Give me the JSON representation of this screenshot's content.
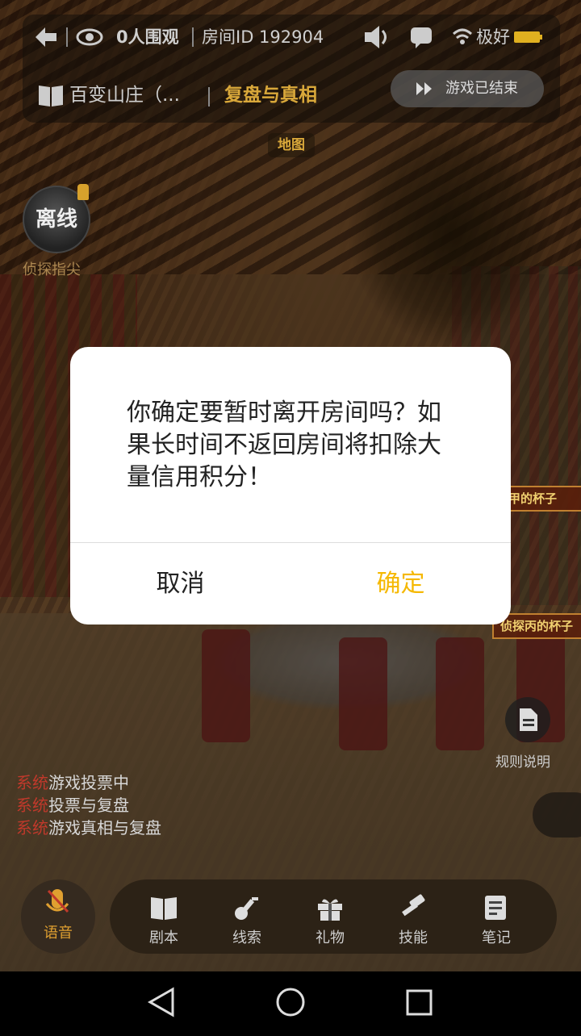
{
  "header": {
    "viewers": "0人围观",
    "room_id": "房间ID 192904",
    "network": "极好",
    "script_title": "百变山庄（...",
    "phase": "复盘与真相",
    "game_status": "游戏已结束",
    "map_label": "地图"
  },
  "player": {
    "status": "离线",
    "name": "侦探指尖"
  },
  "scene_tags": {
    "cup_a": "甲的杯子",
    "cup_b": "侦探丙的杯子"
  },
  "rules": {
    "label": "规则说明"
  },
  "system_log": [
    {
      "source": "系统",
      "message": "游戏投票中"
    },
    {
      "source": "系统",
      "message": "投票与复盘"
    },
    {
      "source": "系统",
      "message": "游戏真相与复盘"
    }
  ],
  "toolbar": {
    "voice": "语音",
    "items": [
      {
        "label": "剧本",
        "icon": "book-icon"
      },
      {
        "label": "线索",
        "icon": "key-icon"
      },
      {
        "label": "礼物",
        "icon": "gift-icon"
      },
      {
        "label": "技能",
        "icon": "hammer-icon"
      },
      {
        "label": "笔记",
        "icon": "note-icon"
      }
    ]
  },
  "dialog": {
    "message": "你确定要暂时离开房间吗？如果长时间不返回房间将扣除大量信用积分！",
    "cancel": "取消",
    "confirm": "确定"
  },
  "colors": {
    "accent": "#F5B800",
    "phase": "#D9A83A",
    "system": "#C0392B"
  }
}
